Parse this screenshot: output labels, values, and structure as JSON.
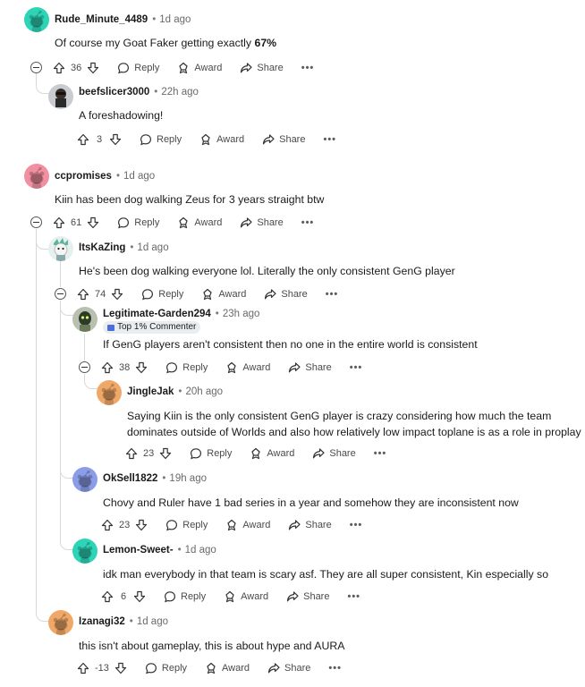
{
  "comments": [
    {
      "id": "c1",
      "author": "Rude_Minute_4489",
      "time": "1d ago",
      "text": "Of course my Goat Faker getting exactly ",
      "text_bold": "67%",
      "votes": "36",
      "avatar_color": "#2ed4b6"
    },
    {
      "id": "c2",
      "author": "beefslicer3000",
      "time": "22h ago",
      "text": "A foreshadowing!",
      "votes": "3",
      "avatar_color": "#c8ccd0"
    },
    {
      "id": "c3",
      "author": "ccpromises",
      "time": "1d ago",
      "text": "Kiin has been dog walking Zeus for 3 years straight btw",
      "votes": "61",
      "avatar_color": "#f28fa0"
    },
    {
      "id": "c4",
      "author": "ItsKaZing",
      "time": "1d ago",
      "text": "He's been dog walking everyone lol. Literally the only consistent GenG player",
      "votes": "74",
      "avatar_color": "#d8e8e4"
    },
    {
      "id": "c5",
      "author": "Legitimate-Garden294",
      "time": "23h ago",
      "badge": "Top 1% Commenter",
      "text": "If GenG players aren't consistent then no one in the entire world is consistent",
      "votes": "38",
      "avatar_color": "#8a9a7a"
    },
    {
      "id": "c6",
      "author": "JingleJak",
      "time": "20h ago",
      "text_lines": [
        "Saying Kiin is the only consistent GenG player is crazy considering how much the team",
        "dominates outside of Worlds and also how relatively low impact toplane is as a role in proplay"
      ],
      "votes": "23",
      "avatar_color": "#f0a868"
    },
    {
      "id": "c7",
      "author": "OkSell1822",
      "time": "19h ago",
      "text": "Chovy and Ruler have 1 bad series in a year and somehow they are inconsistent now",
      "votes": "23",
      "avatar_color": "#8b9de8"
    },
    {
      "id": "c8",
      "author": "Lemon-Sweet-",
      "time": "1d ago",
      "text": "idk man everybody in that team is scary asf. They are all super consistent, Kin especially so",
      "votes": "6",
      "avatar_color": "#2ed4b6"
    },
    {
      "id": "c9",
      "author": "Izanagi32",
      "time": "1d ago",
      "text": "this isn't about gameplay, this is about hype and AURA",
      "votes": "-13",
      "avatar_color": "#f0a868"
    }
  ],
  "actions": {
    "reply": "Reply",
    "award": "Award",
    "share": "Share",
    "more": "•••"
  },
  "dot": "•"
}
